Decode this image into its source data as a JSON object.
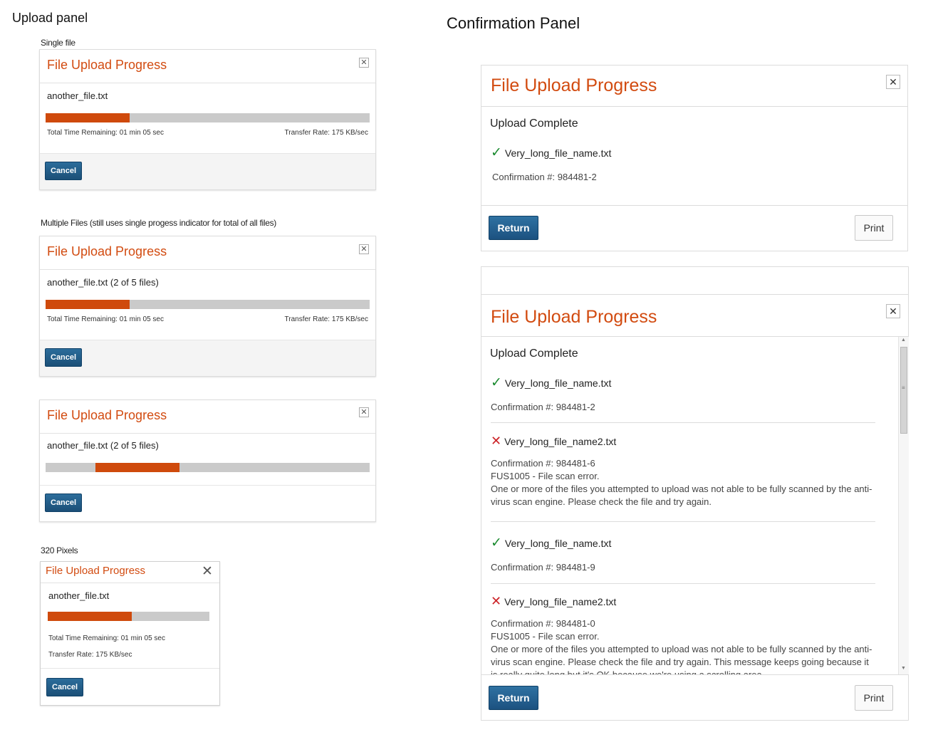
{
  "upload_section": {
    "title": "Upload panel",
    "captions": {
      "single": "Single file",
      "multiple": "Multiple Files (still uses single progess indicator for total of all files)",
      "small": "320 Pixels"
    },
    "dialogs": [
      {
        "title": "File Upload Progress",
        "file": "another_file.txt",
        "progress": 0.26,
        "time_remaining": "Total Time Remaining: 01 min 05 sec",
        "transfer_rate": "Transfer Rate: 175 KB/sec",
        "cancel": "Cancel"
      },
      {
        "title": "File Upload Progress",
        "file": "another_file.txt (2 of 5 files)",
        "progress": 0.26,
        "time_remaining": "Total Time Remaining: 01 min 05 sec",
        "transfer_rate": "Transfer Rate: 175 KB/sec",
        "cancel": "Cancel"
      },
      {
        "title": "File Upload Progress",
        "file": "another_file.txt (2 of 5 files)",
        "progress_state": "indeterminate",
        "cancel": "Cancel"
      },
      {
        "title": "File Upload Progress",
        "file": "another_file.txt",
        "progress": 0.52,
        "time_remaining": "Total Time Remaining: 01 min 05 sec",
        "transfer_rate": "Transfer Rate: 175 KB/sec",
        "cancel": "Cancel"
      }
    ]
  },
  "confirmation_section": {
    "title": "Confirmation Panel",
    "panel1": {
      "title": "File Upload Progress",
      "heading": "Upload Complete",
      "items": [
        {
          "status": "success",
          "name": "Very_long_file_name.txt",
          "confirmation": "Confirmation #: 984481-2"
        }
      ],
      "return": "Return",
      "print": "Print"
    },
    "panel2": {
      "title": "File Upload Progress",
      "heading": "Upload Complete",
      "items": [
        {
          "status": "success",
          "name": "Very_long_file_name.txt",
          "confirmation": "Confirmation #: 984481-2"
        },
        {
          "status": "error",
          "name": "Very_long_file_name2.txt",
          "confirmation": "Confirmation #: 984481-6",
          "error_code": "FUS1005 - File scan error.",
          "message": "One or more of the files you attempted to upload was not able to be fully scanned by the anti-virus scan engine. Please check the file and try again."
        },
        {
          "status": "success",
          "name": "Very_long_file_name.txt",
          "confirmation": "Confirmation #: 984481-9"
        },
        {
          "status": "error",
          "name": "Very_long_file_name2.txt",
          "confirmation": "Confirmation #: 984481-0",
          "error_code": "FUS1005 - File scan error.",
          "message": "One or more of the files you attempted to upload was not able to be fully scanned by the anti-virus scan engine. Please check the file and try again. This message keeps going because it is really quite long but it's OK because we're using a scrolling area."
        }
      ],
      "return": "Return",
      "print": "Print"
    }
  },
  "icons": {
    "close": "✕",
    "check": "✓",
    "error": "✕",
    "scroll_up": "▲",
    "scroll_down": "▼",
    "grip": "≡"
  },
  "colors": {
    "accent": "#d24b10",
    "progress": "#cf4a0c",
    "button": "#1c5280",
    "success": "#1a8a2f",
    "error": "#cc2227"
  }
}
